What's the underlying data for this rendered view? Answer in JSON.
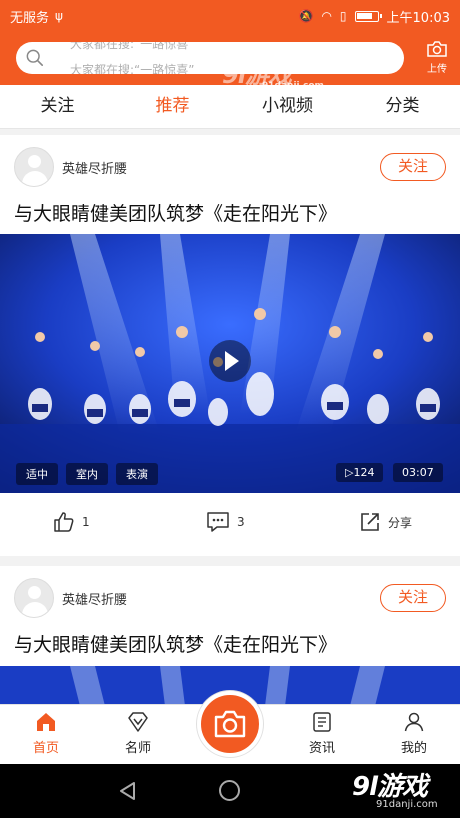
{
  "status_bar": {
    "carrier": "无服务",
    "time": "上午10:03"
  },
  "search": {
    "ghost_text": "大家都在搜:“一路惊喜”",
    "hint": "大家都在搜:“一路惊喜”",
    "placeholder": ""
  },
  "watermark": {
    "logo": "9l游戏",
    "site": "91danji.com"
  },
  "upload": {
    "label": "上传"
  },
  "tabs": [
    {
      "label": "关注"
    },
    {
      "label": "推荐"
    },
    {
      "label": "小视频"
    },
    {
      "label": "分类"
    }
  ],
  "active_tab": 1,
  "posts": [
    {
      "author": "英雄尽折腰",
      "follow_label": "关注",
      "title": "与大眼睛健美团队筑梦《走在阳光下》",
      "tags": [
        "适中",
        "室内",
        "表演"
      ],
      "plays": "▷124",
      "duration": "03:07",
      "likes": "1",
      "comments": "3",
      "share_label": "分享"
    },
    {
      "author": "英雄尽折腰",
      "follow_label": "关注",
      "title": "与大眼睛健美团队筑梦《走在阳光下》"
    }
  ],
  "bottom_nav": [
    {
      "label": "首页",
      "icon": "home-icon"
    },
    {
      "label": "名师",
      "icon": "diamond-icon"
    },
    {
      "label": "资讯",
      "icon": "news-icon"
    },
    {
      "label": "我的",
      "icon": "user-icon"
    }
  ],
  "camera_icon": "camera-icon",
  "colors": {
    "accent": "#f25a22",
    "stage_blue": "#1a3dc4"
  }
}
